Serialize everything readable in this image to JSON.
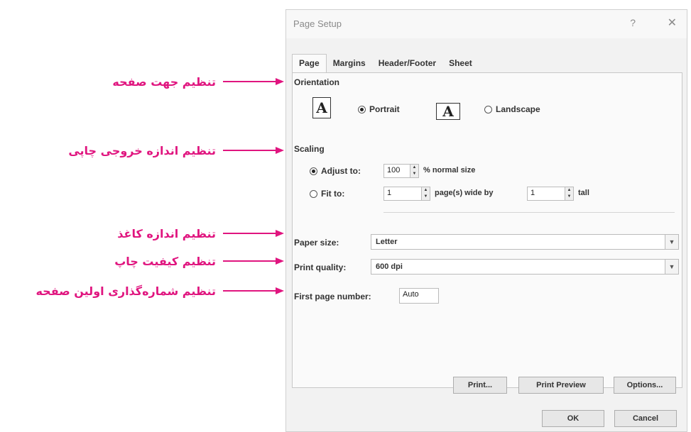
{
  "annotations": [
    {
      "text": "تنظیم جهت صفحه"
    },
    {
      "text": "تنظیم اندازه خروجی چاپی"
    },
    {
      "text": "تنظیم اندازه کاغذ"
    },
    {
      "text": "تنظیم کیفیت چاپ"
    },
    {
      "text": "تنظیم شماره‌گذاری اولین صفحه"
    }
  ],
  "colors": {
    "annotation": "#e0157f",
    "dialog_bg": "#f2f2f2"
  },
  "dialog": {
    "title": "Page Setup",
    "help_label": "?",
    "close_icon": "close-icon",
    "tabs": [
      {
        "label": "Page",
        "active": true
      },
      {
        "label": "Margins"
      },
      {
        "label": "Header/Footer"
      },
      {
        "label": "Sheet"
      }
    ],
    "orientation": {
      "label": "Orientation",
      "portrait_icon": "A",
      "portrait_label": "Portrait",
      "landscape_icon": "A",
      "landscape_label": "Landscape",
      "selected": "portrait"
    },
    "scaling": {
      "label": "Scaling",
      "adjust_label": "Adjust to:",
      "adjust_value": "100",
      "adjust_suffix": "% normal size",
      "fit_label": "Fit to:",
      "fit_wide_value": "1",
      "fit_wide_suffix": "page(s) wide by",
      "fit_tall_value": "1",
      "fit_tall_suffix": "tall",
      "selected": "adjust"
    },
    "paper_size": {
      "label": "Paper size:",
      "value": "Letter"
    },
    "print_quality": {
      "label": "Print quality:",
      "value": "600 dpi"
    },
    "first_page": {
      "label": "First page number:",
      "value": "Auto"
    },
    "buttons": {
      "print": "Print...",
      "print_preview": "Print Preview",
      "options": "Options...",
      "ok": "OK",
      "cancel": "Cancel"
    }
  }
}
